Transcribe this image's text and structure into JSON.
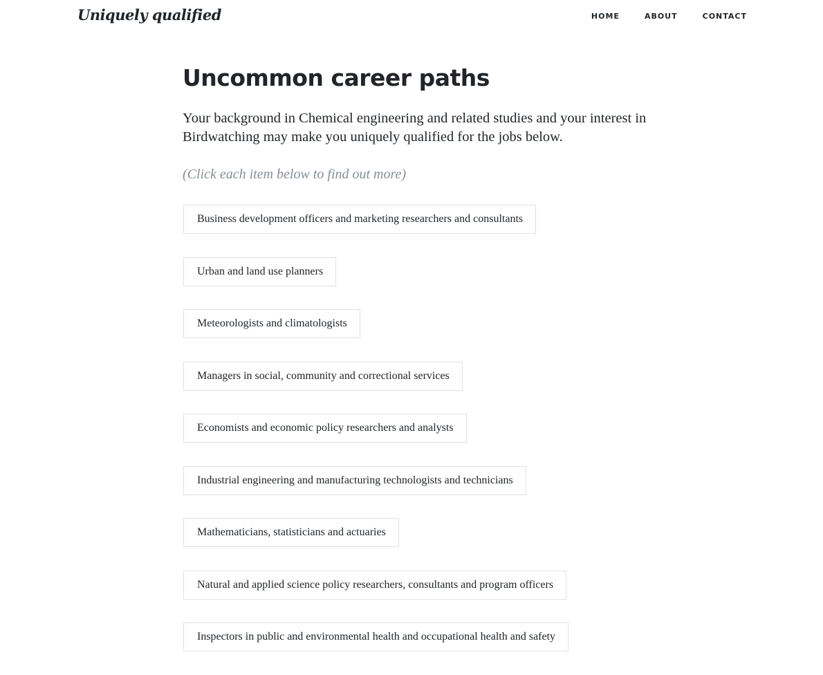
{
  "navbar": {
    "brand": "Uniquely qualified",
    "links": [
      {
        "label": "HOME"
      },
      {
        "label": "ABOUT"
      },
      {
        "label": "CONTACT"
      }
    ]
  },
  "main": {
    "title": "Uncommon career paths",
    "intro": "Your background in Chemical engineering and related studies and your interest in Birdwatching may make you uniquely qualified for the jobs below.",
    "hint": "(Click each item below to find out more)",
    "jobs": [
      {
        "label": "Business development officers and marketing researchers and consultants"
      },
      {
        "label": "Urban and land use planners"
      },
      {
        "label": "Meteorologists and climatologists"
      },
      {
        "label": "Managers in social, community and correctional services"
      },
      {
        "label": "Economists and economic policy researchers and analysts"
      },
      {
        "label": "Industrial engineering and manufacturing technologists and technicians"
      },
      {
        "label": "Mathematicians, statisticians and actuaries"
      },
      {
        "label": "Natural and applied science policy researchers, consultants and program officers"
      },
      {
        "label": "Inspectors in public and environmental health and occupational health and safety"
      }
    ]
  }
}
